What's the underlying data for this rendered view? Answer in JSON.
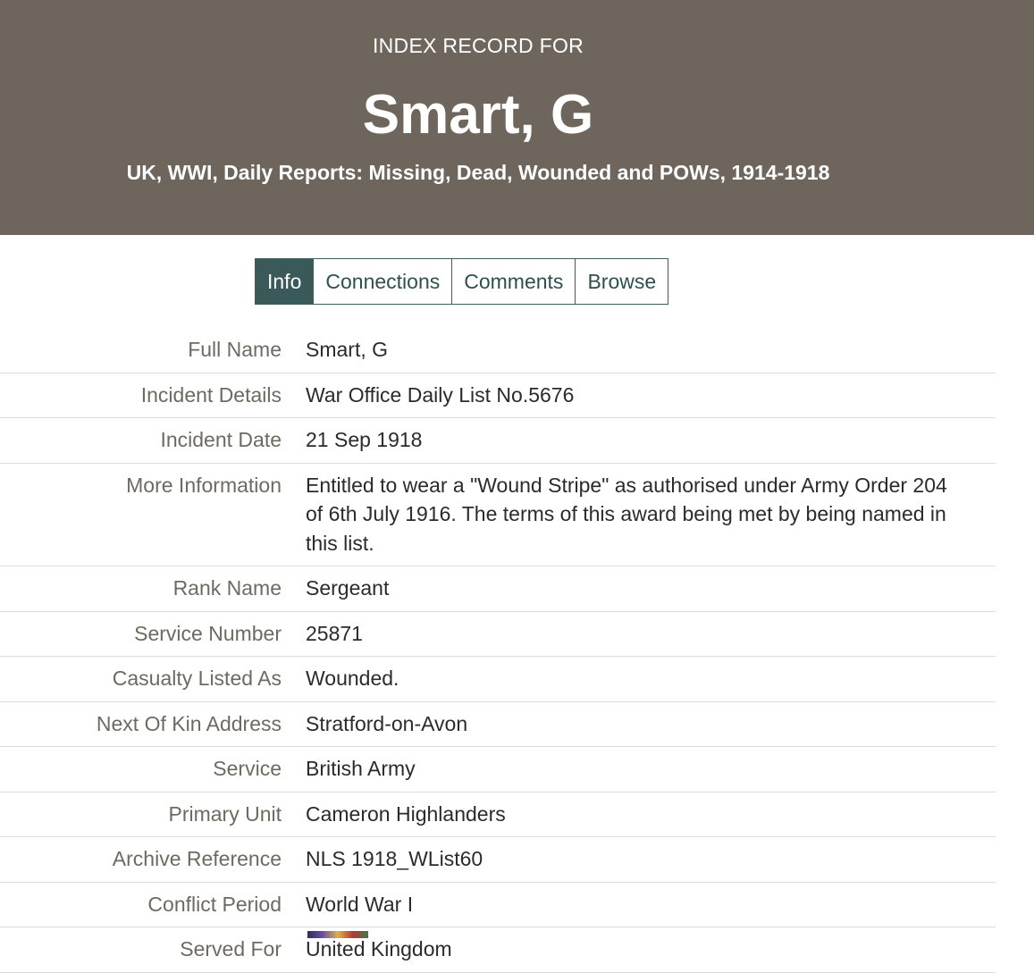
{
  "header": {
    "kicker": "INDEX RECORD FOR",
    "name": "Smart, G",
    "collection": "UK, WWI, Daily Reports: Missing, Dead, Wounded and POWs, 1914-1918"
  },
  "tabs": [
    {
      "label": "Info",
      "active": true
    },
    {
      "label": "Connections",
      "active": false
    },
    {
      "label": "Comments",
      "active": false
    },
    {
      "label": "Browse",
      "active": false
    }
  ],
  "record": [
    {
      "label": "Full Name",
      "value": "Smart, G"
    },
    {
      "label": "Incident Details",
      "value": "War Office Daily List No.5676"
    },
    {
      "label": "Incident Date",
      "value": "21 Sep 1918"
    },
    {
      "label": "More Information",
      "value": "Entitled to wear a \"Wound Stripe\" as authorised under Army Order 204 of 6th July 1916. The terms of this award being met by being named in this list."
    },
    {
      "label": "Rank Name",
      "value": "Sergeant"
    },
    {
      "label": "Service Number",
      "value": "25871"
    },
    {
      "label": "Casualty Listed As",
      "value": "Wounded."
    },
    {
      "label": "Next Of Kin Address",
      "value": "Stratford-on-Avon"
    },
    {
      "label": "Service",
      "value": "British Army"
    },
    {
      "label": "Primary Unit",
      "value": "Cameron Highlanders"
    },
    {
      "label": "Archive Reference",
      "value": "NLS 1918_WList60"
    },
    {
      "label": "Conflict Period",
      "value": "World War I"
    },
    {
      "label": "Served For",
      "value": "United Kingdom"
    }
  ],
  "colors": {
    "header_bg": "#6e665c",
    "tab_active_bg": "#3a5a59",
    "tab_border": "#3d5e5c",
    "label_text": "#6f6a61"
  }
}
